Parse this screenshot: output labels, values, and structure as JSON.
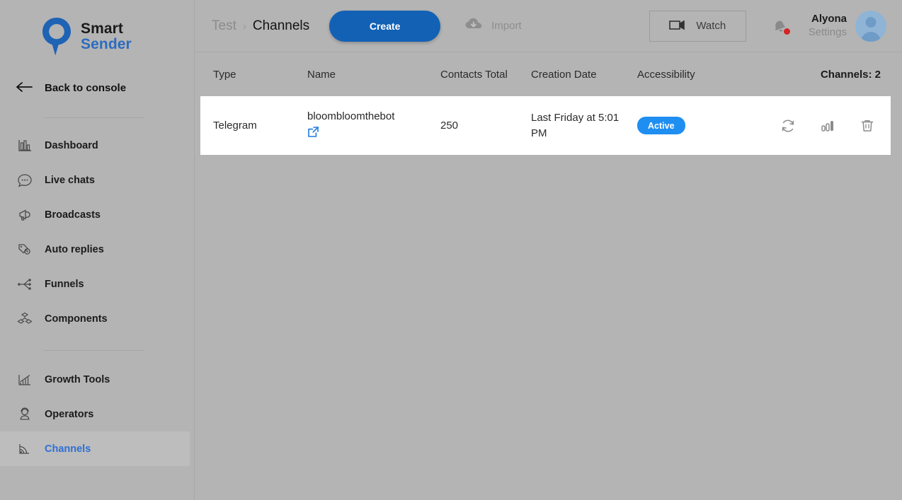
{
  "brand": {
    "logo_icon": "smart-sender-pin-logo",
    "name_line1": "Smart",
    "name_line2": "Sender",
    "accent_blue": "#2c6cbf"
  },
  "sidebar": {
    "back": {
      "label": "Back to console",
      "icon": "arrow-left-icon"
    },
    "items": [
      {
        "label": "Dashboard",
        "icon": "bar-chart-icon",
        "active": false
      },
      {
        "label": "Live chats",
        "icon": "chat-bubble-icon",
        "active": false
      },
      {
        "label": "Broadcasts",
        "icon": "megaphone-icon",
        "active": false
      },
      {
        "label": "Auto replies",
        "icon": "tag-gear-icon",
        "active": false
      },
      {
        "label": "Funnels",
        "icon": "sitemap-icon",
        "active": false
      },
      {
        "label": "Components",
        "icon": "blocks-icon",
        "active": false
      }
    ],
    "items2": [
      {
        "label": "Growth Tools",
        "icon": "growth-chart-icon",
        "active": false
      },
      {
        "label": "Operators",
        "icon": "headset-user-icon",
        "active": false
      },
      {
        "label": "Channels",
        "icon": "rss-signal-icon",
        "active": true
      }
    ]
  },
  "topbar": {
    "breadcrumb": {
      "parent": "Test",
      "separator": "›",
      "current": "Channels"
    },
    "create_label": "Create",
    "import": {
      "label": "Import",
      "icon": "cloud-download-icon"
    },
    "watch": {
      "label": "Watch",
      "icon": "video-camera-icon"
    },
    "notifications": {
      "icon": "bell-icon",
      "has_unread": true,
      "dot_color": "#d42424"
    },
    "user": {
      "name": "Alyona",
      "settings_label": "Settings",
      "avatar_icon": "user-avatar-icon"
    }
  },
  "table": {
    "columns": {
      "type": "Type",
      "name": "Name",
      "contacts": "Contacts Total",
      "creation_date": "Creation Date",
      "accessibility": "Accessibility"
    },
    "count_label": "Channels: 2",
    "rows": [
      {
        "type": "Telegram",
        "name": "bloombloomthebot",
        "name_link_icon": "external-link-icon",
        "contacts_total": "250",
        "creation_date": "Last Friday at 5:01 PM",
        "status": "Active",
        "status_color": "#1f8ef1",
        "actions": [
          {
            "icon": "refresh-icon"
          },
          {
            "icon": "statistics-icon"
          },
          {
            "icon": "trash-icon"
          }
        ]
      }
    ]
  }
}
